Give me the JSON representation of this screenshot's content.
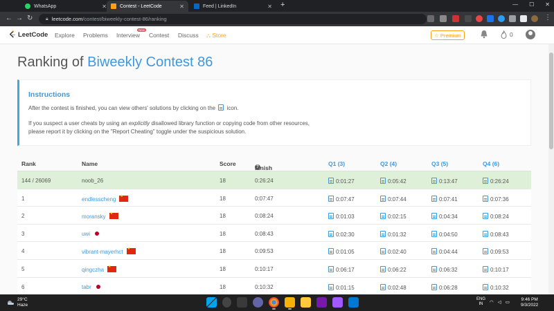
{
  "browser": {
    "tabs": [
      {
        "label": "WhatsApp",
        "active": false
      },
      {
        "label": "Contest - LeetCode",
        "active": true
      },
      {
        "label": "Feed | LinkedIn",
        "active": false
      }
    ],
    "url_host": "leetcode.com",
    "url_path": "/contest/biweekly-contest-86/ranking"
  },
  "nav": {
    "logo": "LeetCode",
    "links": [
      "Explore",
      "Problems",
      "Interview",
      "Contest",
      "Discuss",
      "Store"
    ],
    "new_badge": "New",
    "premium": "Premium",
    "flame_count": "0"
  },
  "page": {
    "title_prefix": "Ranking of ",
    "title_contest": "Biweekly Contest 86"
  },
  "instructions": {
    "heading": "Instructions",
    "line1_before": "After the contest is finished, you can view others' solutions by clicking on the",
    "line1_after": "icon.",
    "line2_a": "If you suspect a user cheats by using an",
    "line2_em": "explicitly",
    "line2_b": "disallowed library function or copying code from other resources,",
    "line3": "please report it by clicking on the \"Report Cheating\" toggle under the suspicious solution."
  },
  "table": {
    "headers": {
      "rank": "Rank",
      "name": "Name",
      "score": "Score",
      "finish": "Finish Time",
      "q1": "Q1 (3)",
      "q2": "Q2 (4)",
      "q3": "Q3 (5)",
      "q4": "Q4 (6)"
    },
    "rows": [
      {
        "rank": "144 / 26069",
        "name": "noob_26",
        "flag": "",
        "score": "18",
        "finish": "0:26:24",
        "q1": "0:01:27",
        "q2": "0:05:42",
        "q3": "0:13:47",
        "q4": "0:26:24",
        "self": true
      },
      {
        "rank": "1",
        "name": "endlesscheng",
        "flag": "cn",
        "score": "18",
        "finish": "0:07:47",
        "q1": "0:07:47",
        "q2": "0:07:44",
        "q3": "0:07:41",
        "q4": "0:07:36"
      },
      {
        "rank": "2",
        "name": "moransky",
        "flag": "cn",
        "score": "18",
        "finish": "0:08:24",
        "q1": "0:01:03",
        "q2": "0:02:15",
        "q3": "0:04:34",
        "q4": "0:08:24"
      },
      {
        "rank": "3",
        "name": "uwi",
        "flag": "jp",
        "score": "18",
        "finish": "0:08:43",
        "q1": "0:02:30",
        "q2": "0:01:32",
        "q3": "0:04:50",
        "q4": "0:08:43"
      },
      {
        "rank": "4",
        "name": "vibrant-mayerhct",
        "flag": "cn",
        "score": "18",
        "finish": "0:09:53",
        "q1": "0:01:05",
        "q2": "0:02:40",
        "q3": "0:04:44",
        "q4": "0:09:53"
      },
      {
        "rank": "5",
        "name": "qingczha",
        "flag": "cn",
        "score": "18",
        "finish": "0:10:17",
        "q1": "0:06:17",
        "q2": "0:06:22",
        "q3": "0:06:32",
        "q4": "0:10:17"
      },
      {
        "rank": "6",
        "name": "tabr",
        "flag": "jp",
        "score": "18",
        "finish": "0:10:32",
        "q1": "0:01:15",
        "q2": "0:02:48",
        "q3": "0:06:28",
        "q4": "0:10:32"
      }
    ]
  },
  "taskbar": {
    "temp": "29°C",
    "weather": "Haze",
    "lang1": "ENG",
    "lang2": "IN",
    "time": "9:46 PM",
    "date": "9/3/2022"
  },
  "colors": {
    "accent": "#3e98de",
    "brand": "#ffa116",
    "self_row": "#dff0d8"
  }
}
